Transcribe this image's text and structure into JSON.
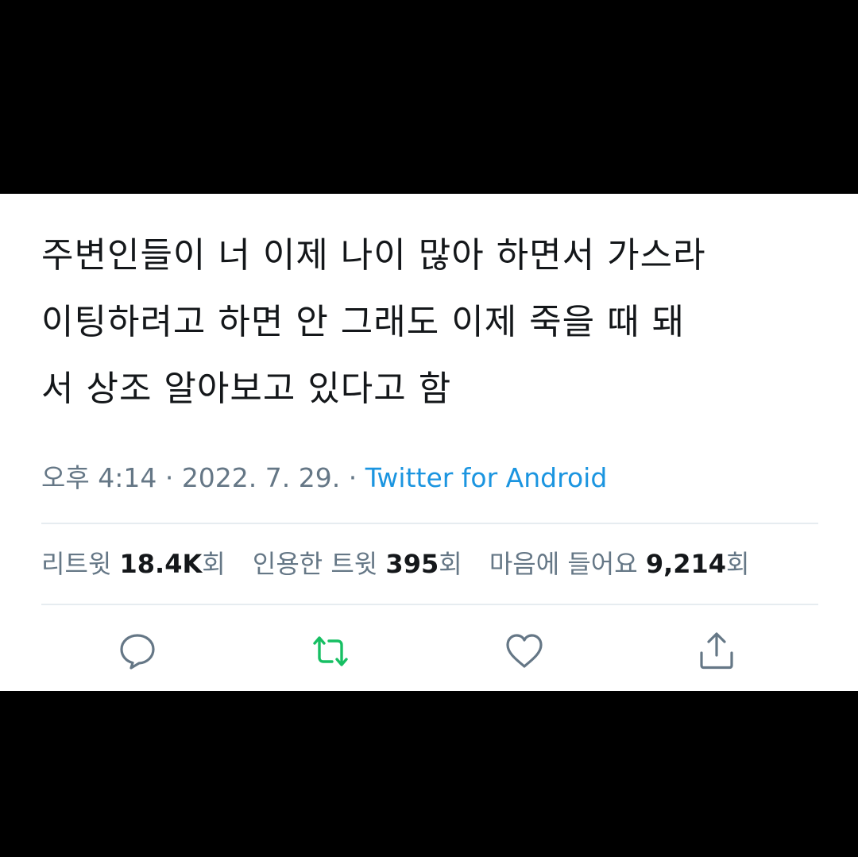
{
  "tweet": {
    "line1": "주변인들이 너 이제 나이 많아 하면서 가스라",
    "line2": "이팅하려고 하면 안 그래도 이제 죽을 때 돼",
    "line3": "서 상조 알아보고 있다고 함",
    "time": "오후 4:14",
    "sep1": " · ",
    "date": "2022. 7. 29.",
    "sep2": " · ",
    "source": "Twitter for Android"
  },
  "stats": {
    "retweets_label": "리트윗",
    "retweets_value": "18.4K",
    "retweets_unit": "회",
    "quotes_label": "인용한 트윗",
    "quotes_value": "395",
    "quotes_unit": "회",
    "likes_label": "마음에 들어요",
    "likes_value": "9,214",
    "likes_unit": "회"
  },
  "actions": {
    "reply_icon": "reply-icon",
    "retweet_icon": "retweet-icon",
    "like_icon": "heart-icon",
    "share_icon": "share-icon"
  },
  "colors": {
    "text": "#14171a",
    "muted": "#657786",
    "link": "#1b95e0",
    "retweet_active": "#17bf63",
    "divider": "#e6ecf0"
  }
}
